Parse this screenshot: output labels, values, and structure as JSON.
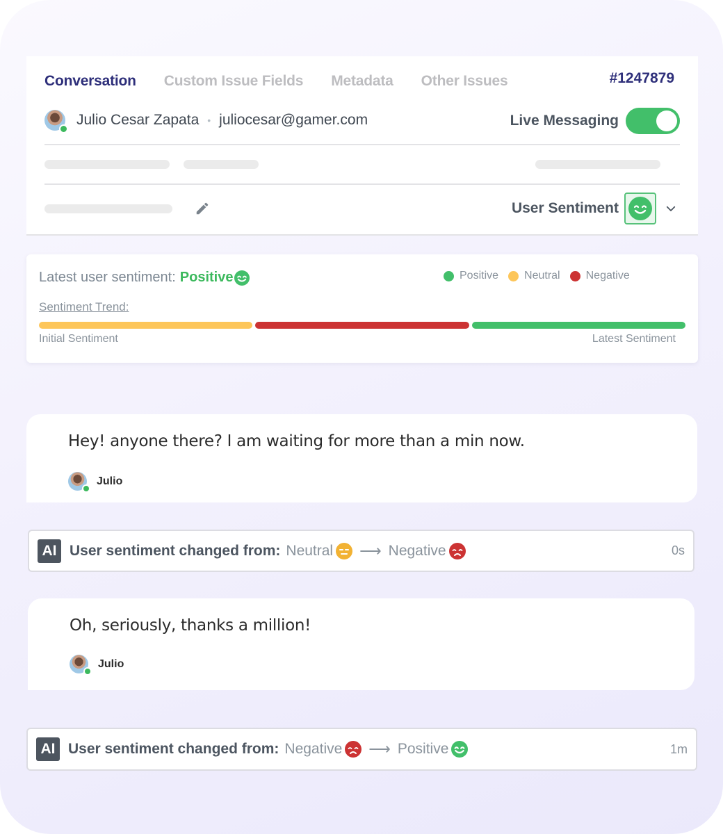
{
  "header": {
    "tabs": [
      {
        "label": "Conversation",
        "active": true
      },
      {
        "label": "Custom Issue Fields",
        "active": false
      },
      {
        "label": "Metadata",
        "active": false
      },
      {
        "label": "Other Issues",
        "active": false
      }
    ],
    "issue_id": "#1247879",
    "user": {
      "name": "Julio Cesar Zapata",
      "separator": "•",
      "email": "juliocesar@gamer.com",
      "status": "online"
    },
    "live_messaging": {
      "label": "Live Messaging",
      "enabled": true
    },
    "user_sentiment": {
      "label": "User Sentiment",
      "value": "Positive",
      "icon": "smile-icon"
    },
    "icons": {
      "edit": "pencil-icon",
      "dropdown": "chevron-down-icon"
    }
  },
  "sentiment_summary": {
    "latest_label": "Latest user sentiment:",
    "latest_value": "Positive",
    "legend": [
      {
        "label": "Positive",
        "color": "#42bf6a"
      },
      {
        "label": "Neutral",
        "color": "#fdc65a"
      },
      {
        "label": "Negative",
        "color": "#cc3333"
      }
    ],
    "trend_title": "Sentiment Trend:",
    "trend": [
      "Neutral",
      "Negative",
      "Positive"
    ],
    "trend_start_label": "Initial Sentiment",
    "trend_end_label": "Latest Sentiment"
  },
  "colors": {
    "positive": "#42bf6a",
    "neutral": "#fdc65a",
    "negative": "#cc3333",
    "accent": "#2e2f7a"
  },
  "timeline": [
    {
      "type": "message",
      "text": "Hey! anyone there? I am waiting for more than a min now.",
      "author": "Julio"
    },
    {
      "type": "ai_event",
      "badge": "AI",
      "label": "User sentiment changed from:",
      "from": "Neutral",
      "to": "Negative",
      "time": "0s"
    },
    {
      "type": "message",
      "text": "Oh, seriously, thanks a million!",
      "author": "Julio"
    },
    {
      "type": "ai_event",
      "badge": "AI",
      "label": "User sentiment changed from:",
      "from": "Negative",
      "to": "Positive",
      "time": "1m"
    }
  ]
}
